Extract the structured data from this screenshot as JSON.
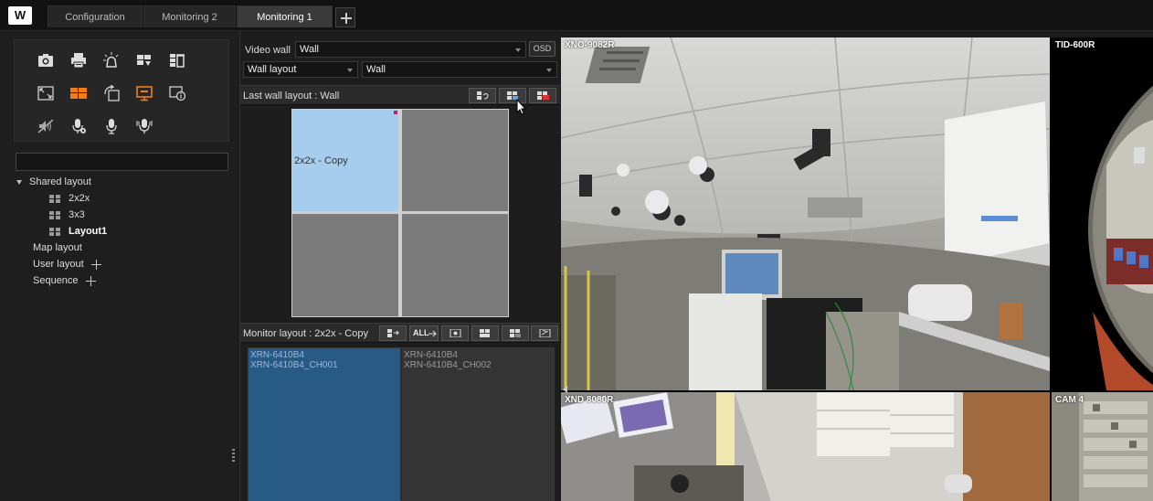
{
  "app": {
    "logo_text": "W",
    "tabs": [
      {
        "label": "Configuration",
        "active": false
      },
      {
        "label": "Monitoring 2",
        "active": false
      },
      {
        "label": "Monitoring 1",
        "active": true
      }
    ]
  },
  "toolbar": {
    "tools": [
      {
        "icon": "camera-icon"
      },
      {
        "icon": "print-icon"
      },
      {
        "icon": "alarm-light-icon"
      },
      {
        "icon": "layout-save-icon"
      },
      {
        "icon": "layout-delete-icon"
      },
      {
        "icon": "fullscreen-icon"
      },
      {
        "icon": "grid-layout-icon",
        "active": true
      },
      {
        "icon": "rotate-icon"
      },
      {
        "icon": "monitor-icon",
        "active": true
      },
      {
        "icon": "monitor-info-icon"
      },
      {
        "icon": "mute-icon"
      },
      {
        "icon": "mic-settings-icon"
      },
      {
        "icon": "mic-icon"
      },
      {
        "icon": "mic-broadcast-icon"
      }
    ]
  },
  "search": {
    "value": ""
  },
  "tree": {
    "shared_layout": "Shared layout",
    "children": [
      "2x2x",
      "3x3",
      "Layout1"
    ],
    "map_layout": "Map layout",
    "user_layout": "User layout",
    "sequence": "Sequence"
  },
  "videowall": {
    "video_wall_label": "Video wall",
    "video_wall_value": "Wall",
    "osd_label": "OSD",
    "wall_layout_value": "Wall layout",
    "wall_value": "Wall",
    "last_wall_layout": "Last wall layout : Wall",
    "selected_cell_label": "2x2x - Copy",
    "monitor_layout": "Monitor layout : 2x2x - Copy",
    "all_button": "ALL",
    "monitors": [
      {
        "line1": "XRN-6410B4",
        "line2": "XRN-6410B4_CH001"
      },
      {
        "line1": "XRN-6410B4",
        "line2": "XRN-6410B4_CH002"
      }
    ]
  },
  "video": {
    "tiles": [
      {
        "label": "XNO-9082R"
      },
      {
        "label": "TID-600R"
      },
      {
        "label": "XND 8080R"
      },
      {
        "label": "CAM 4"
      }
    ]
  }
}
